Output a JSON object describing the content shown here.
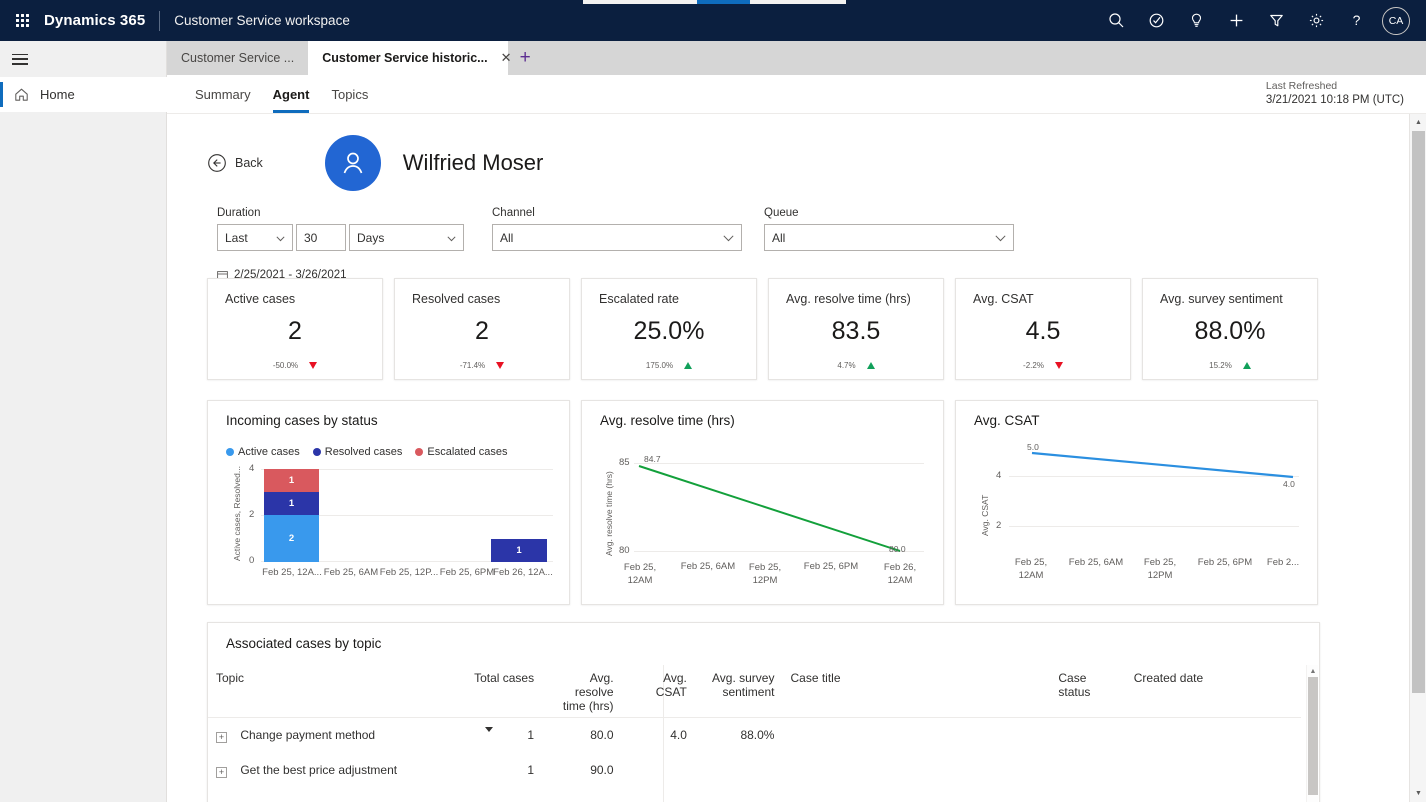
{
  "header": {
    "waffle_icon": "app-launcher-icon",
    "brand": "Dynamics 365",
    "app_name": "Customer Service workspace",
    "actions": [
      {
        "name": "search-icon",
        "label": "Search"
      },
      {
        "name": "assistant-icon",
        "label": "Assistant"
      },
      {
        "name": "lightbulb-icon",
        "label": "Insights"
      },
      {
        "name": "plus-icon",
        "label": "New"
      },
      {
        "name": "filter-icon",
        "label": "Filter"
      },
      {
        "name": "gear-icon",
        "label": "Settings"
      },
      {
        "name": "help-icon",
        "label": "Help"
      }
    ],
    "avatar_initials": "CA"
  },
  "left_rail": {
    "hamburger_icon": "hamburger-icon",
    "items": [
      {
        "label": "Home",
        "icon": "home-icon",
        "active": true
      }
    ]
  },
  "tabs": {
    "items": [
      {
        "label": "Customer Service ...",
        "active": false
      },
      {
        "label": "Customer Service historic...",
        "active": true
      }
    ],
    "close_glyph": "✕",
    "new_tab_glyph": "+"
  },
  "sub_nav": {
    "items": [
      {
        "label": "Summary",
        "active": false
      },
      {
        "label": "Agent",
        "active": true
      },
      {
        "label": "Topics",
        "active": false
      }
    ],
    "refresh_label": "Last Refreshed",
    "refresh_value": "3/21/2021 10:18 PM (UTC)"
  },
  "agent": {
    "back_label": "Back",
    "name": "Wilfried Moser",
    "avatar_icon": "person-icon"
  },
  "filters": {
    "duration": {
      "label": "Duration",
      "relative": "Last",
      "amount": "30",
      "unit": "Days"
    },
    "channel": {
      "label": "Channel",
      "value": "All"
    },
    "queue": {
      "label": "Queue",
      "value": "All"
    },
    "date_range": "2/25/2021 - 3/26/2021",
    "calendar_icon": "calendar-icon",
    "caret_glyph": "∨"
  },
  "kpis": [
    {
      "title": "Active cases",
      "value": "2",
      "delta": "-50.0%",
      "direction": "down"
    },
    {
      "title": "Resolved cases",
      "value": "2",
      "delta": "-71.4%",
      "direction": "down"
    },
    {
      "title": "Escalated rate",
      "value": "25.0%",
      "delta": "175.0%",
      "direction": "up"
    },
    {
      "title": "Avg. resolve time (hrs)",
      "value": "83.5",
      "delta": "4.7%",
      "direction": "up"
    },
    {
      "title": "Avg. CSAT",
      "value": "4.5",
      "delta": "-2.2%",
      "direction": "down"
    },
    {
      "title": "Avg. survey sentiment",
      "value": "88.0%",
      "delta": "15.2%",
      "direction": "up"
    }
  ],
  "chart_data": [
    {
      "type": "bar",
      "title": "Incoming cases by status",
      "stacked": true,
      "xlabel": "",
      "ylabel": "Active cases, Resolved...",
      "categories": [
        "Feb 25, 12A...",
        "Feb 25, 6AM",
        "Feb 25, 12P...",
        "Feb 25, 6PM",
        "Feb 26, 12A..."
      ],
      "series": [
        {
          "name": "Active cases",
          "color": "#3999ed",
          "values": [
            2,
            0,
            0,
            0,
            0
          ]
        },
        {
          "name": "Resolved cases",
          "color": "#2b35a8",
          "values": [
            1,
            0,
            0,
            0,
            1
          ]
        },
        {
          "name": "Escalated cases",
          "color": "#d9595e",
          "values": [
            1,
            0,
            0,
            0,
            0
          ]
        }
      ],
      "yticks": [
        0,
        2,
        4
      ],
      "ylim": [
        0,
        4
      ],
      "grid": true,
      "legend": "top"
    },
    {
      "type": "line",
      "title": "Avg. resolve time (hrs)",
      "xlabel": "",
      "ylabel": "Avg. resolve time (hrs)",
      "categories": [
        "Feb 25, 12AM",
        "Feb 25, 6AM",
        "Feb 25, 12PM",
        "Feb 25, 6PM",
        "Feb 26, 12AM"
      ],
      "series": [
        {
          "name": "Avg. resolve time (hrs)",
          "color": "#13a03b",
          "values": [
            84.7,
            null,
            null,
            null,
            80.0
          ]
        }
      ],
      "point_labels": [
        "84.7",
        "80.0"
      ],
      "yticks": [
        80,
        85
      ],
      "ylim": [
        80,
        85
      ],
      "grid": true,
      "legend": "none"
    },
    {
      "type": "line",
      "title": "Avg. CSAT",
      "xlabel": "",
      "ylabel": "Avg. CSAT",
      "categories": [
        "Feb 25, 12AM",
        "Feb 25, 6AM",
        "Feb 25, 12PM",
        "Feb 25, 6PM",
        "Feb 2..."
      ],
      "series": [
        {
          "name": "Avg. CSAT",
          "color": "#2b8fe0",
          "values": [
            5.0,
            null,
            null,
            null,
            4.0
          ]
        }
      ],
      "point_labels": [
        "5.0",
        "4.0"
      ],
      "yticks": [
        2,
        4
      ],
      "ylim": [
        0,
        5.4
      ],
      "grid": true,
      "legend": "none"
    }
  ],
  "table": {
    "title": "Associated cases by topic",
    "columns": [
      "Topic",
      "Total cases",
      "Avg. resolve time (hrs)",
      "Avg. CSAT",
      "Avg. survey sentiment",
      "Case title",
      "Case status",
      "Created date"
    ],
    "sorted_column": "Total cases",
    "sort_direction": "desc",
    "rows": [
      {
        "topic": "Change payment method",
        "total_cases": "1",
        "avg_resolve_time": "80.0",
        "avg_csat": "4.0",
        "avg_survey_sentiment": "88.0%",
        "case_title": "",
        "case_status": "",
        "created_date": ""
      },
      {
        "topic": "Get the best price adjustment",
        "total_cases": "1",
        "avg_resolve_time": "90.0",
        "avg_csat": "",
        "avg_survey_sentiment": "",
        "case_title": "",
        "case_status": "",
        "created_date": ""
      }
    ],
    "expander_glyph": "+"
  },
  "colors": {
    "header_bg": "#0b1f3f",
    "accent": "#0f6cbd",
    "up": "#11a05a",
    "down": "#e81123"
  }
}
